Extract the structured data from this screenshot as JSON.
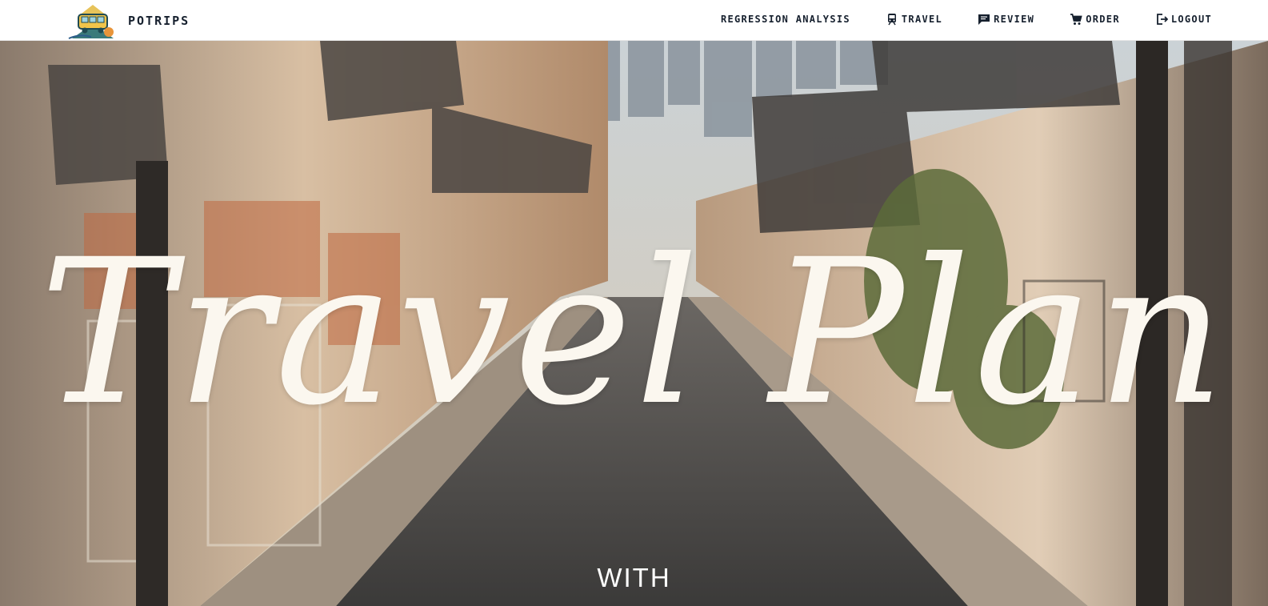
{
  "brand": {
    "name": "POTRIPS",
    "logo_icon": "travel-van-icon"
  },
  "nav": [
    {
      "id": "regression",
      "label": "REGRESSION ANALYSIS",
      "icon": ""
    },
    {
      "id": "travel",
      "label": "TRAVEL",
      "icon": "train-icon"
    },
    {
      "id": "review",
      "label": "REVIEW",
      "icon": "comment-icon"
    },
    {
      "id": "order",
      "label": "ORDER",
      "icon": "cart-icon"
    },
    {
      "id": "logout",
      "label": "LOGOUT",
      "icon": "logout-icon"
    }
  ],
  "hero": {
    "title": "Travel Plan",
    "subtitle": "WITH"
  },
  "colors": {
    "nav_text": "#16202e",
    "hero_text": "#fbf7ef"
  }
}
